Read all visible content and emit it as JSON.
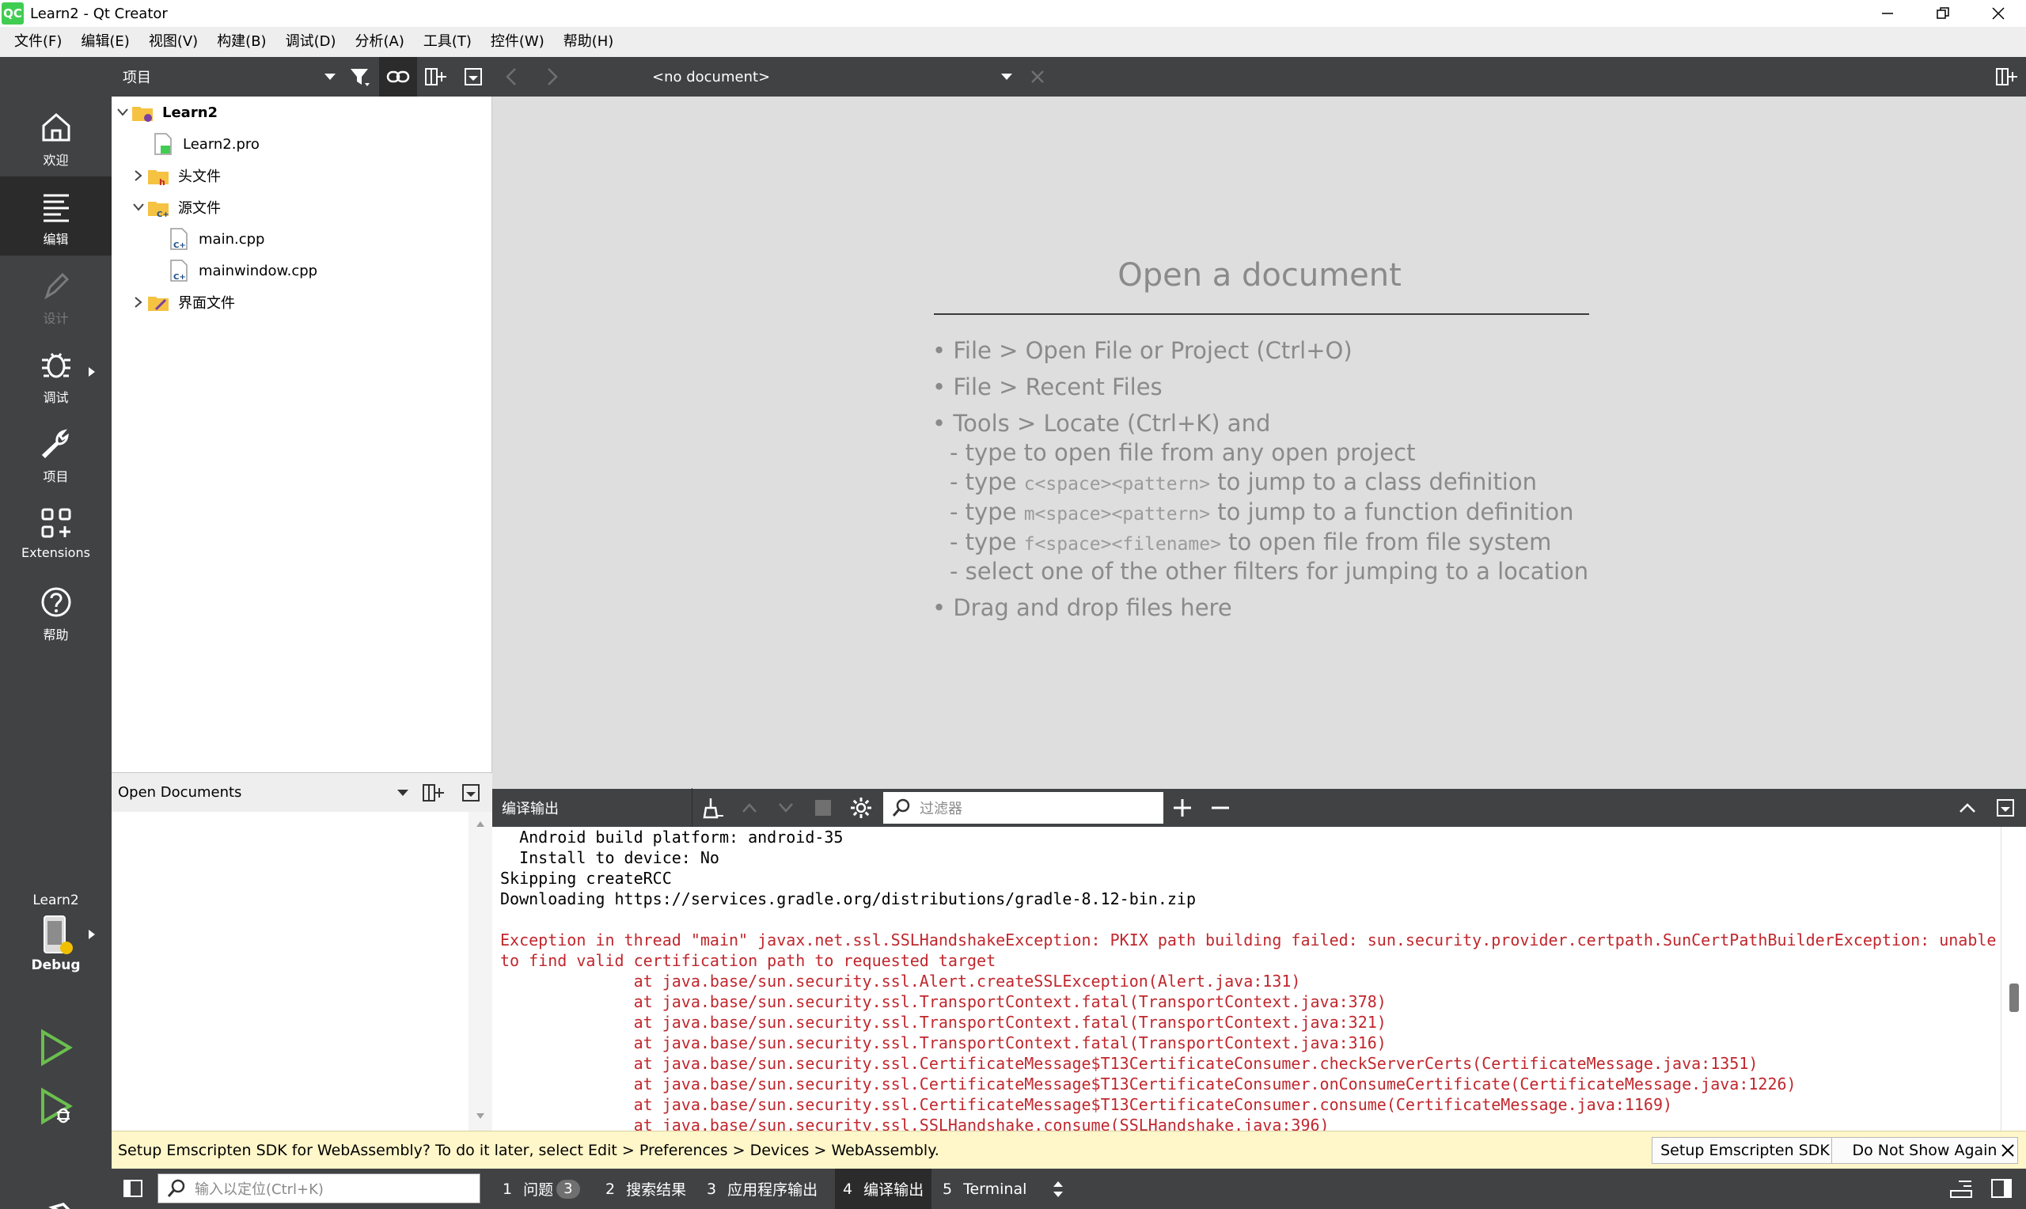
{
  "window": {
    "icon_text": "QC",
    "title": "Learn2 - Qt Creator"
  },
  "menu": [
    "文件(F)",
    "编辑(E)",
    "视图(V)",
    "构建(B)",
    "调试(D)",
    "分析(A)",
    "工具(T)",
    "控件(W)",
    "帮助(H)"
  ],
  "modes": {
    "welcome": "欢迎",
    "edit": "编辑",
    "design": "设计",
    "debug": "调试",
    "projects": "项目",
    "extensions": "Extensions",
    "help": "帮助"
  },
  "kit": {
    "project": "Learn2",
    "config": "Debug"
  },
  "project_pane": {
    "selector": "项目"
  },
  "tree": {
    "root": "Learn2",
    "pro": "Learn2.pro",
    "headers": "头文件",
    "sources": "源文件",
    "main_cpp": "main.cpp",
    "mainwindow_cpp": "mainwindow.cpp",
    "forms": "界面文件"
  },
  "open_docs": {
    "title": "Open Documents"
  },
  "editor": {
    "doc_selector": "<no document>"
  },
  "welcome": {
    "title": "Open a document",
    "l1": "• File > Open File or Project (Ctrl+O)",
    "l2": "• File > Recent Files",
    "l3": "• Tools > Locate (Ctrl+K) and",
    "l4": "- type to open file from any open project",
    "l5a": "- type ",
    "l5m": "c<space><pattern>",
    "l5b": " to jump to a class definition",
    "l6a": "- type ",
    "l6m": "m<space><pattern>",
    "l6b": " to jump to a function definition",
    "l7a": "- type ",
    "l7m": "f<space><filename>",
    "l7b": " to open file from file system",
    "l8": "- select one of the other filters for jumping to a location",
    "l9": "• Drag and drop files here"
  },
  "output": {
    "title": "编译输出",
    "filter_placeholder": "过滤器",
    "lines": [
      {
        "t": "  Android build platform: android-35",
        "err": false
      },
      {
        "t": "  Install to device: No",
        "err": false
      },
      {
        "t": "Skipping createRCC",
        "err": false
      },
      {
        "t": "Downloading https://services.gradle.org/distributions/gradle-8.12-bin.zip",
        "err": false
      },
      {
        "t": "",
        "err": false
      },
      {
        "t": "Exception in thread \"main\" javax.net.ssl.SSLHandshakeException: PKIX path building failed: sun.security.provider.certpath.SunCertPathBuilderException: unable",
        "err": true
      },
      {
        "t": "to find valid certification path to requested target",
        "err": true
      },
      {
        "t": "              at java.base/sun.security.ssl.Alert.createSSLException(Alert.java:131)",
        "err": true
      },
      {
        "t": "              at java.base/sun.security.ssl.TransportContext.fatal(TransportContext.java:378)",
        "err": true
      },
      {
        "t": "              at java.base/sun.security.ssl.TransportContext.fatal(TransportContext.java:321)",
        "err": true
      },
      {
        "t": "              at java.base/sun.security.ssl.TransportContext.fatal(TransportContext.java:316)",
        "err": true
      },
      {
        "t": "              at java.base/sun.security.ssl.CertificateMessage$T13CertificateConsumer.checkServerCerts(CertificateMessage.java:1351)",
        "err": true
      },
      {
        "t": "              at java.base/sun.security.ssl.CertificateMessage$T13CertificateConsumer.onConsumeCertificate(CertificateMessage.java:1226)",
        "err": true
      },
      {
        "t": "              at java.base/sun.security.ssl.CertificateMessage$T13CertificateConsumer.consume(CertificateMessage.java:1169)",
        "err": true
      },
      {
        "t": "              at java.base/sun.security.ssl.SSLHandshake.consume(SSLHandshake.java:396)",
        "err": true
      }
    ]
  },
  "infobar": {
    "text": "Setup Emscripten SDK for WebAssembly? To do it later, select Edit > Preferences > Devices > WebAssembly.",
    "setup_button": "Setup Emscripten SDK",
    "dismiss_button": "Do Not Show Again"
  },
  "statusbar": {
    "locator_placeholder": "输入以定位(Ctrl+K)",
    "tabs": [
      {
        "num": "1",
        "label": "问题",
        "badge": "3"
      },
      {
        "num": "2",
        "label": "搜索结果"
      },
      {
        "num": "3",
        "label": "应用程序输出"
      },
      {
        "num": "4",
        "label": "编译输出"
      },
      {
        "num": "5",
        "label": "Terminal"
      }
    ]
  },
  "colors": {
    "accent_build": "#6bbf4e",
    "error_text": "#c0272d",
    "sidebar": "#404244",
    "debug_dot": "#f0c000"
  }
}
